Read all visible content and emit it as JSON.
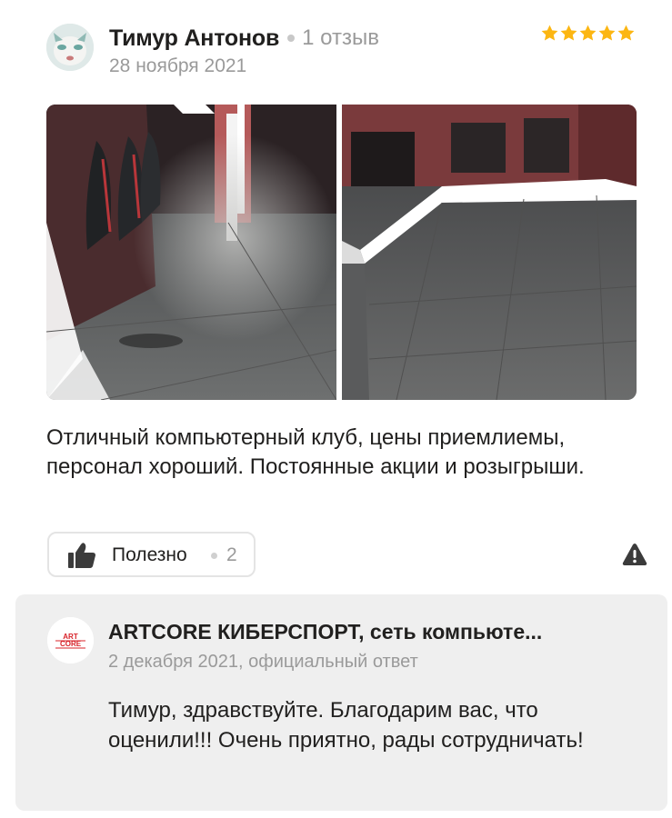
{
  "author": {
    "name": "Тимур Антонов",
    "reviews_count": "1 отзыв",
    "date": "28 ноября 2021",
    "avatar_icon": "user-avatar"
  },
  "rating": {
    "stars": 5,
    "max": 5,
    "color": "#fcb612"
  },
  "photos": [
    {
      "icon": "club-room-photo-chairs"
    },
    {
      "icon": "club-room-photo-floor"
    }
  ],
  "review_text": "Отличный компьютерный клуб, цены приемлиемы, персонал хороший. Постоянные акции и розыгрыши.",
  "actions": {
    "useful_label": "Полезно",
    "useful_count": "2",
    "useful_icon": "thumbs-up-icon",
    "report_icon": "warning-icon"
  },
  "reply": {
    "logo_icon": "artcore-logo",
    "logo_text": "ARTCORE",
    "title": "ARTCORE КИБЕРСПОРТ, сеть компьюте...",
    "meta": "2 декабря 2021, официальный ответ",
    "text": "Тимур, здравствуйте. Благодарим вас, что оценили!!! Очень приятно, рады сотрудничать!"
  },
  "colors": {
    "star": "#fcb612",
    "muted_text": "#9a9a9a",
    "reply_bg": "#efefef",
    "logo_red": "#d8232a"
  }
}
